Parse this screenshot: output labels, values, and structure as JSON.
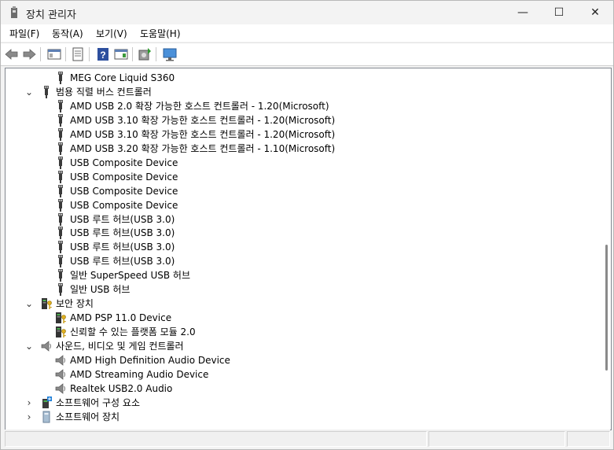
{
  "window": {
    "title": "장치 관리자",
    "minimize": "—",
    "maximize": "☐",
    "close": "✕"
  },
  "menu": [
    "파일(F)",
    "동작(A)",
    "보기(V)",
    "도움말(H)"
  ],
  "toolbar": [
    "back-icon",
    "forward-icon",
    "show-hide-console-tree-icon",
    "properties-icon",
    "help-icon",
    "action-pane-icon",
    "update-driver-icon",
    "monitor-scan-icon"
  ],
  "tree": [
    {
      "label": "MEG Core Liquid S360",
      "level": 1,
      "icon": "usb"
    },
    {
      "label": "범용 직렬 버스 컨트롤러",
      "level": 0,
      "icon": "usb",
      "expanded": true
    },
    {
      "label": "AMD USB 2.0 확장 가능한 호스트 컨트롤러 - 1.20(Microsoft)",
      "level": 1,
      "icon": "usb"
    },
    {
      "label": "AMD USB 3.10 확장 가능한 호스트 컨트롤러 - 1.20(Microsoft)",
      "level": 1,
      "icon": "usb"
    },
    {
      "label": "AMD USB 3.10 확장 가능한 호스트 컨트롤러 - 1.20(Microsoft)",
      "level": 1,
      "icon": "usb"
    },
    {
      "label": "AMD USB 3.20 확장 가능한 호스트 컨트롤러 - 1.10(Microsoft)",
      "level": 1,
      "icon": "usb"
    },
    {
      "label": "USB Composite Device",
      "level": 1,
      "icon": "usb"
    },
    {
      "label": "USB Composite Device",
      "level": 1,
      "icon": "usb"
    },
    {
      "label": "USB Composite Device",
      "level": 1,
      "icon": "usb"
    },
    {
      "label": "USB Composite Device",
      "level": 1,
      "icon": "usb"
    },
    {
      "label": "USB 루트 허브(USB 3.0)",
      "level": 1,
      "icon": "usb"
    },
    {
      "label": "USB 루트 허브(USB 3.0)",
      "level": 1,
      "icon": "usb"
    },
    {
      "label": "USB 루트 허브(USB 3.0)",
      "level": 1,
      "icon": "usb"
    },
    {
      "label": "USB 루트 허브(USB 3.0)",
      "level": 1,
      "icon": "usb"
    },
    {
      "label": "일반 SuperSpeed USB 허브",
      "level": 1,
      "icon": "usb"
    },
    {
      "label": "일반 USB 허브",
      "level": 1,
      "icon": "usb"
    },
    {
      "label": "보안 장치",
      "level": 0,
      "icon": "security",
      "expanded": true
    },
    {
      "label": "AMD PSP 11.0 Device",
      "level": 1,
      "icon": "security"
    },
    {
      "label": "신뢰할 수 있는 플랫폼 모듈 2.0",
      "level": 1,
      "icon": "security"
    },
    {
      "label": "사운드, 비디오 및 게임 컨트롤러",
      "level": 0,
      "icon": "speaker",
      "expanded": true
    },
    {
      "label": "AMD High Definition Audio Device",
      "level": 1,
      "icon": "speaker"
    },
    {
      "label": "AMD Streaming Audio Device",
      "level": 1,
      "icon": "speaker"
    },
    {
      "label": "Realtek USB2.0 Audio",
      "level": 1,
      "icon": "speaker"
    },
    {
      "label": "소프트웨어 구성 요소",
      "level": 0,
      "icon": "component",
      "expanded": false
    },
    {
      "label": "소프트웨어 장치",
      "level": 0,
      "icon": "device",
      "expanded": false
    }
  ]
}
